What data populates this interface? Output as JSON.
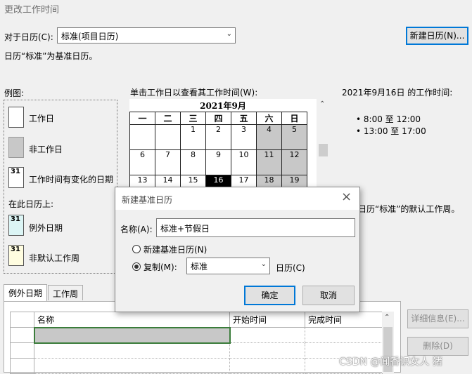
{
  "window": {
    "title": "更改工作时间"
  },
  "top": {
    "for_calendar_label": "对于日历(C):",
    "calendar_value": "标准(项目日历)",
    "new_calendar_button": "新建日历(N)...",
    "base_note": "日历“标准”为基准日历。"
  },
  "legend": {
    "title": "例图:",
    "working": "工作日",
    "nonworking": "非工作日",
    "changed": "工作时间有变化的日期",
    "changed_num": "31",
    "on_calendar": "在此日历上:",
    "exception": "例外日期",
    "exception_num": "31",
    "nondefault": "非默认工作周",
    "nondefault_num": "31"
  },
  "calendar": {
    "instruction": "单击工作日以查看其工作时间(W):",
    "month_title": "2021年9月",
    "weekdays": [
      "一",
      "二",
      "三",
      "四",
      "五",
      "六",
      "日"
    ],
    "rows": [
      [
        "",
        "",
        "1",
        "2",
        "3",
        "4",
        "5"
      ],
      [
        "6",
        "7",
        "8",
        "9",
        "10",
        "11",
        "12"
      ],
      [
        "13",
        "14",
        "15",
        "16",
        "17",
        "18",
        "19"
      ]
    ]
  },
  "worktime": {
    "heading": "2021年9月16日 的工作时间:",
    "slots": [
      "8:00 至 12:00",
      "13:00 至 17:00"
    ],
    "footnote": "日历“标准”的默认工作周。"
  },
  "tabs": [
    {
      "label": "例外日期"
    },
    {
      "label": "工作周"
    }
  ],
  "exceptions_table": {
    "columns": [
      "",
      "名称",
      "开始时间",
      "完成时间"
    ]
  },
  "side_buttons": {
    "details": "详细信息(E)...",
    "delete": "删除(D)"
  },
  "dialog": {
    "title": "新建基准日历",
    "name_label": "名称(A):",
    "name_value": "标准+节假日",
    "option_new": "新建基准日历(N)",
    "option_copy": "复制(M):",
    "copy_value": "标准",
    "copy_suffix": "日历(C)",
    "ok": "确定",
    "cancel": "取消",
    "close_icon": "×"
  },
  "watermark": "CSDN @闻香识女人 猪"
}
